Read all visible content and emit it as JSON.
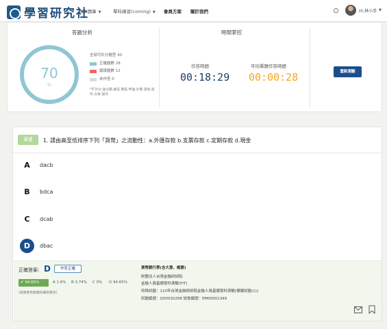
{
  "nav": {
    "logo_text": "學習研究社",
    "items": [
      {
        "label": "QB題庫",
        "has_dropdown": true
      },
      {
        "label": "單科練習(coming)",
        "has_dropdown": true
      },
      {
        "label": "會員方案",
        "has_dropdown": false
      },
      {
        "label": "關於我們",
        "has_dropdown": false
      }
    ],
    "user_greeting": "Hi,林小手"
  },
  "stats": {
    "analysis_title": "答題分析",
    "score": "70",
    "score_unit": "%",
    "total_label": "全部可計分題型 40",
    "correct_label": "正確題數 28",
    "wrong_label": "錯誤題數 12",
    "unanswered_label": "未作答 0",
    "correct_count": 28,
    "wrong_count": 12,
    "unanswered_count": 0,
    "note": "*不計分:送分題,填充,簡答,申論,計算,其他,寫作,文章,操作",
    "time_title": "時間掌控",
    "elapsed_label": "作答時間",
    "elapsed_value": "00:18:29",
    "avg_label": "平均單題作答時間",
    "avg_value": "00:00:28",
    "restart_label": "重新測驗",
    "colors": {
      "correct": "#8fc6d4",
      "wrong": "#e86a5e",
      "unanswered": "#dcdcdc",
      "avg_time": "#f0a72a",
      "elapsed_time": "#1b3f6a"
    }
  },
  "question": {
    "type_tag": "單選",
    "text": "1. 請由高至低排序下列「貨幣」之流動性：a.外匯存款 b.支票存款 c.定期存款 d.現金",
    "options": [
      {
        "letter": "A",
        "text": "dacb",
        "selected": false
      },
      {
        "letter": "B",
        "text": "bdca",
        "selected": false
      },
      {
        "letter": "C",
        "text": "dcab",
        "selected": false
      },
      {
        "letter": "D",
        "text": "dbac",
        "selected": true
      }
    ],
    "answer_label": "正確答案:",
    "answer_letter": "D",
    "answer_button": "作答正確",
    "correct_pct": "94.65%",
    "dist": {
      "a": "A 1.6%",
      "b": "B 3.74%",
      "c": "C 0%",
      "d": "D 94.65%"
    },
    "hint": "(請重整頁面獲得最新資訊)",
    "source": {
      "subject": "貨幣銀行學(含大意、概要)",
      "org": "財團法人台灣金融研訓院",
      "exam": "金融人員基礎學科測驗(FIT)",
      "special": "特殊試題：110年台灣金融研訓院金融人員基礎學科測驗[模擬試題(1)]",
      "ids": "試題編號：Q00030268   試卷編號：EM00001349"
    }
  }
}
